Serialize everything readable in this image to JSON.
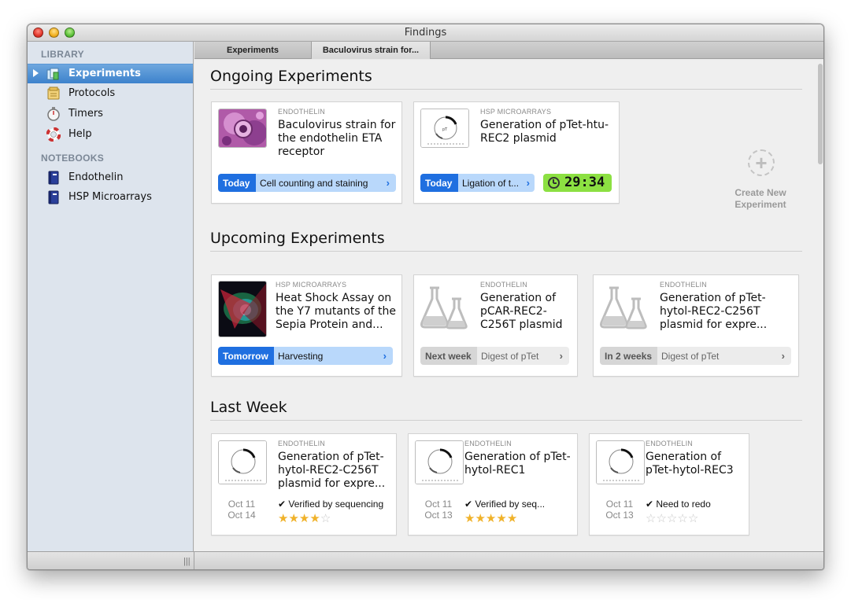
{
  "window": {
    "title": "Findings"
  },
  "sidebar": {
    "library_header": "LIBRARY",
    "library_items": [
      {
        "label": "Experiments",
        "icon": "experiments-icon"
      },
      {
        "label": "Protocols",
        "icon": "protocols-icon"
      },
      {
        "label": "Timers",
        "icon": "timer-icon"
      },
      {
        "label": "Help",
        "icon": "help-lifebuoy-icon"
      }
    ],
    "notebooks_header": "NOTEBOOKS",
    "notebook_items": [
      {
        "label": "Endothelin",
        "icon": "notebook-icon"
      },
      {
        "label": "HSP Microarrays",
        "icon": "notebook-icon"
      }
    ],
    "grip": "|||"
  },
  "tabs": [
    {
      "label": "Experiments"
    },
    {
      "label": "Baculovirus strain for..."
    }
  ],
  "sections": {
    "ongoing": "Ongoing Experiments",
    "upcoming": "Upcoming Experiments",
    "last_week": "Last Week"
  },
  "ongoing": [
    {
      "notebook": "ENDOTHELIN",
      "title": "Baculovirus strain for the endothelin ETA receptor",
      "when": "Today",
      "step": "Cell counting and staining"
    },
    {
      "notebook": "HSP MICROARRAYS",
      "title": "Generation of pTet-htu-REC2 plasmid",
      "when": "Today",
      "step": "Ligation of t...",
      "timer": "29:34"
    }
  ],
  "create": {
    "label": "Create New Experiment",
    "icon": "+"
  },
  "upcoming": [
    {
      "notebook": "HSP MICROARRAYS",
      "title": "Heat Shock Assay on the Y7 mutants of the Sepia Protein and...",
      "when": "Tomorrow",
      "step": "Harvesting"
    },
    {
      "notebook": "ENDOTHELIN",
      "title": "Generation of pCAR-REC2-C256T plasmid",
      "when": "Next week",
      "step": "Digest of pTet"
    },
    {
      "notebook": "ENDOTHELIN",
      "title": "Generation of pTet-hytol-REC2-C256T plasmid for expre...",
      "when": "In 2 weeks",
      "step": "Digest of pTet"
    }
  ],
  "last_week": [
    {
      "notebook": "ENDOTHELIN",
      "title": "Generation of pTet-hytol-REC2-C256T plasmid for expre...",
      "start": "Oct 11",
      "end": "Oct 14",
      "status": "✔ Verified by sequencing",
      "rating": 4
    },
    {
      "notebook": "ENDOTHELIN",
      "title": "Generation of pTet-hytol-REC1",
      "start": "Oct 11",
      "end": "Oct 13",
      "status": "✔ Verified by seq...",
      "rating": 5
    },
    {
      "notebook": "ENDOTHELIN",
      "title": "Generation of pTet-hytol-REC3",
      "start": "Oct 11",
      "end": "Oct 13",
      "status": "✔ Need to redo",
      "rating": 0
    }
  ],
  "colors": {
    "accent": "#1f6fe0",
    "pill_light": "#b9d8fb",
    "timer_green": "#8ce042",
    "star": "#f0b22a",
    "sidebar_bg": "#dde4ed"
  }
}
